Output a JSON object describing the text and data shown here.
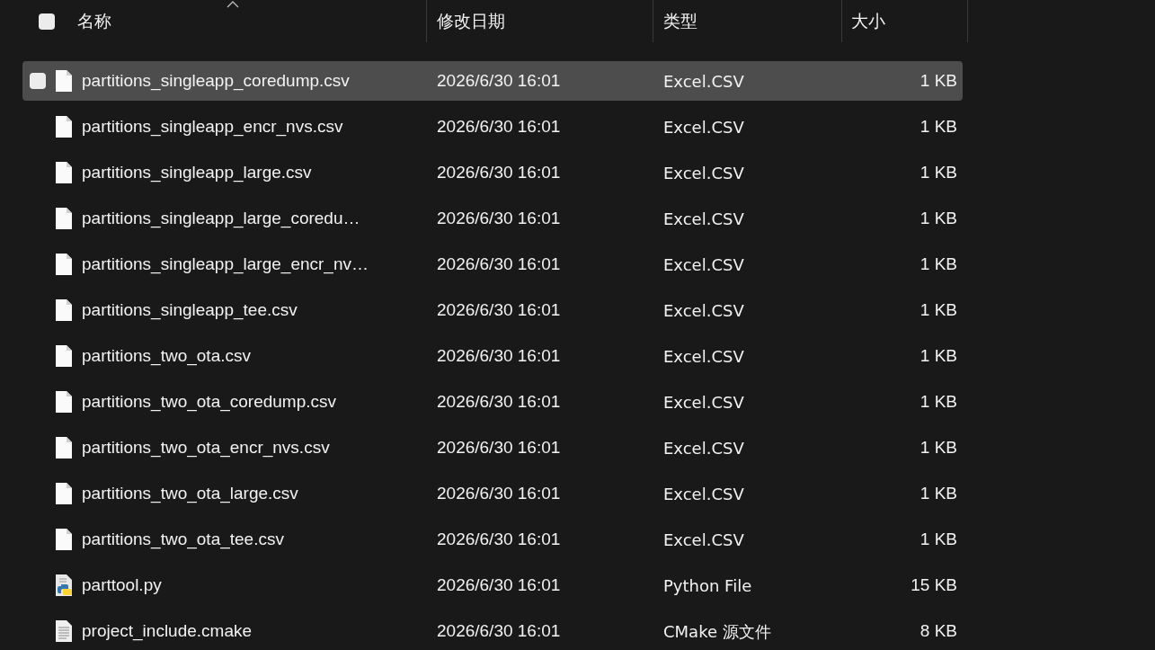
{
  "header": {
    "select_all_checked": false,
    "columns": [
      "名称",
      "修改日期",
      "类型",
      "大小"
    ]
  },
  "rows": [
    {
      "name": "partitions_singleapp_coredump.csv",
      "date": "2026/6/30 16:01",
      "type": "Excel.CSV",
      "size": "1 KB",
      "kind": "file",
      "hovered": true,
      "checked": false
    },
    {
      "name": "partitions_singleapp_encr_nvs.csv",
      "date": "2026/6/30 16:01",
      "type": "Excel.CSV",
      "size": "1 KB",
      "kind": "file",
      "hovered": false,
      "checked": false
    },
    {
      "name": "partitions_singleapp_large.csv",
      "date": "2026/6/30 16:01",
      "type": "Excel.CSV",
      "size": "1 KB",
      "kind": "file",
      "hovered": false,
      "checked": false
    },
    {
      "name": "partitions_singleapp_large_coredu…",
      "date": "2026/6/30 16:01",
      "type": "Excel.CSV",
      "size": "1 KB",
      "kind": "file",
      "hovered": false,
      "checked": false
    },
    {
      "name": "partitions_singleapp_large_encr_nv…",
      "date": "2026/6/30 16:01",
      "type": "Excel.CSV",
      "size": "1 KB",
      "kind": "file",
      "hovered": false,
      "checked": false
    },
    {
      "name": "partitions_singleapp_tee.csv",
      "date": "2026/6/30 16:01",
      "type": "Excel.CSV",
      "size": "1 KB",
      "kind": "file",
      "hovered": false,
      "checked": false
    },
    {
      "name": "partitions_two_ota.csv",
      "date": "2026/6/30 16:01",
      "type": "Excel.CSV",
      "size": "1 KB",
      "kind": "file",
      "hovered": false,
      "checked": false
    },
    {
      "name": "partitions_two_ota_coredump.csv",
      "date": "2026/6/30 16:01",
      "type": "Excel.CSV",
      "size": "1 KB",
      "kind": "file",
      "hovered": false,
      "checked": false
    },
    {
      "name": "partitions_two_ota_encr_nvs.csv",
      "date": "2026/6/30 16:01",
      "type": "Excel.CSV",
      "size": "1 KB",
      "kind": "file",
      "hovered": false,
      "checked": false
    },
    {
      "name": "partitions_two_ota_large.csv",
      "date": "2026/6/30 16:01",
      "type": "Excel.CSV",
      "size": "1 KB",
      "kind": "file",
      "hovered": false,
      "checked": false
    },
    {
      "name": "partitions_two_ota_tee.csv",
      "date": "2026/6/30 16:01",
      "type": "Excel.CSV",
      "size": "1 KB",
      "kind": "file",
      "hovered": false,
      "checked": false
    },
    {
      "name": "parttool.py",
      "date": "2026/6/30 16:01",
      "type": "Python File",
      "size": "15 KB",
      "kind": "python",
      "hovered": false,
      "checked": false
    },
    {
      "name": "project_include.cmake",
      "date": "2026/6/30 16:01",
      "type": "CMake 源文件",
      "size": "8 KB",
      "kind": "text",
      "hovered": false,
      "checked": false
    }
  ]
}
